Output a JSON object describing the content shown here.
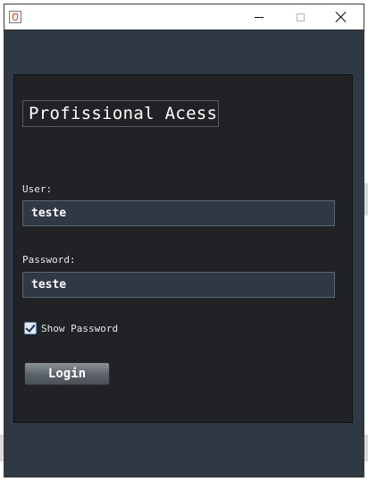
{
  "window": {
    "title": ""
  },
  "form": {
    "heading": "Profissional Acess",
    "user": {
      "label": "User:",
      "value": "teste"
    },
    "password": {
      "label": "Password:",
      "value": "teste"
    },
    "show_password": {
      "label": "Show Password",
      "checked": true
    },
    "login_button": "Login"
  },
  "colors": {
    "window_bg": "#2e3944",
    "panel_bg": "#202225",
    "field_bg": "#2e3944",
    "text": "#ffffff"
  },
  "icons": {
    "app": "java-cup-icon",
    "minimize": "minimize-icon",
    "maximize": "maximize-icon",
    "close": "close-icon",
    "checkbox": "checkbox-checked-icon"
  }
}
